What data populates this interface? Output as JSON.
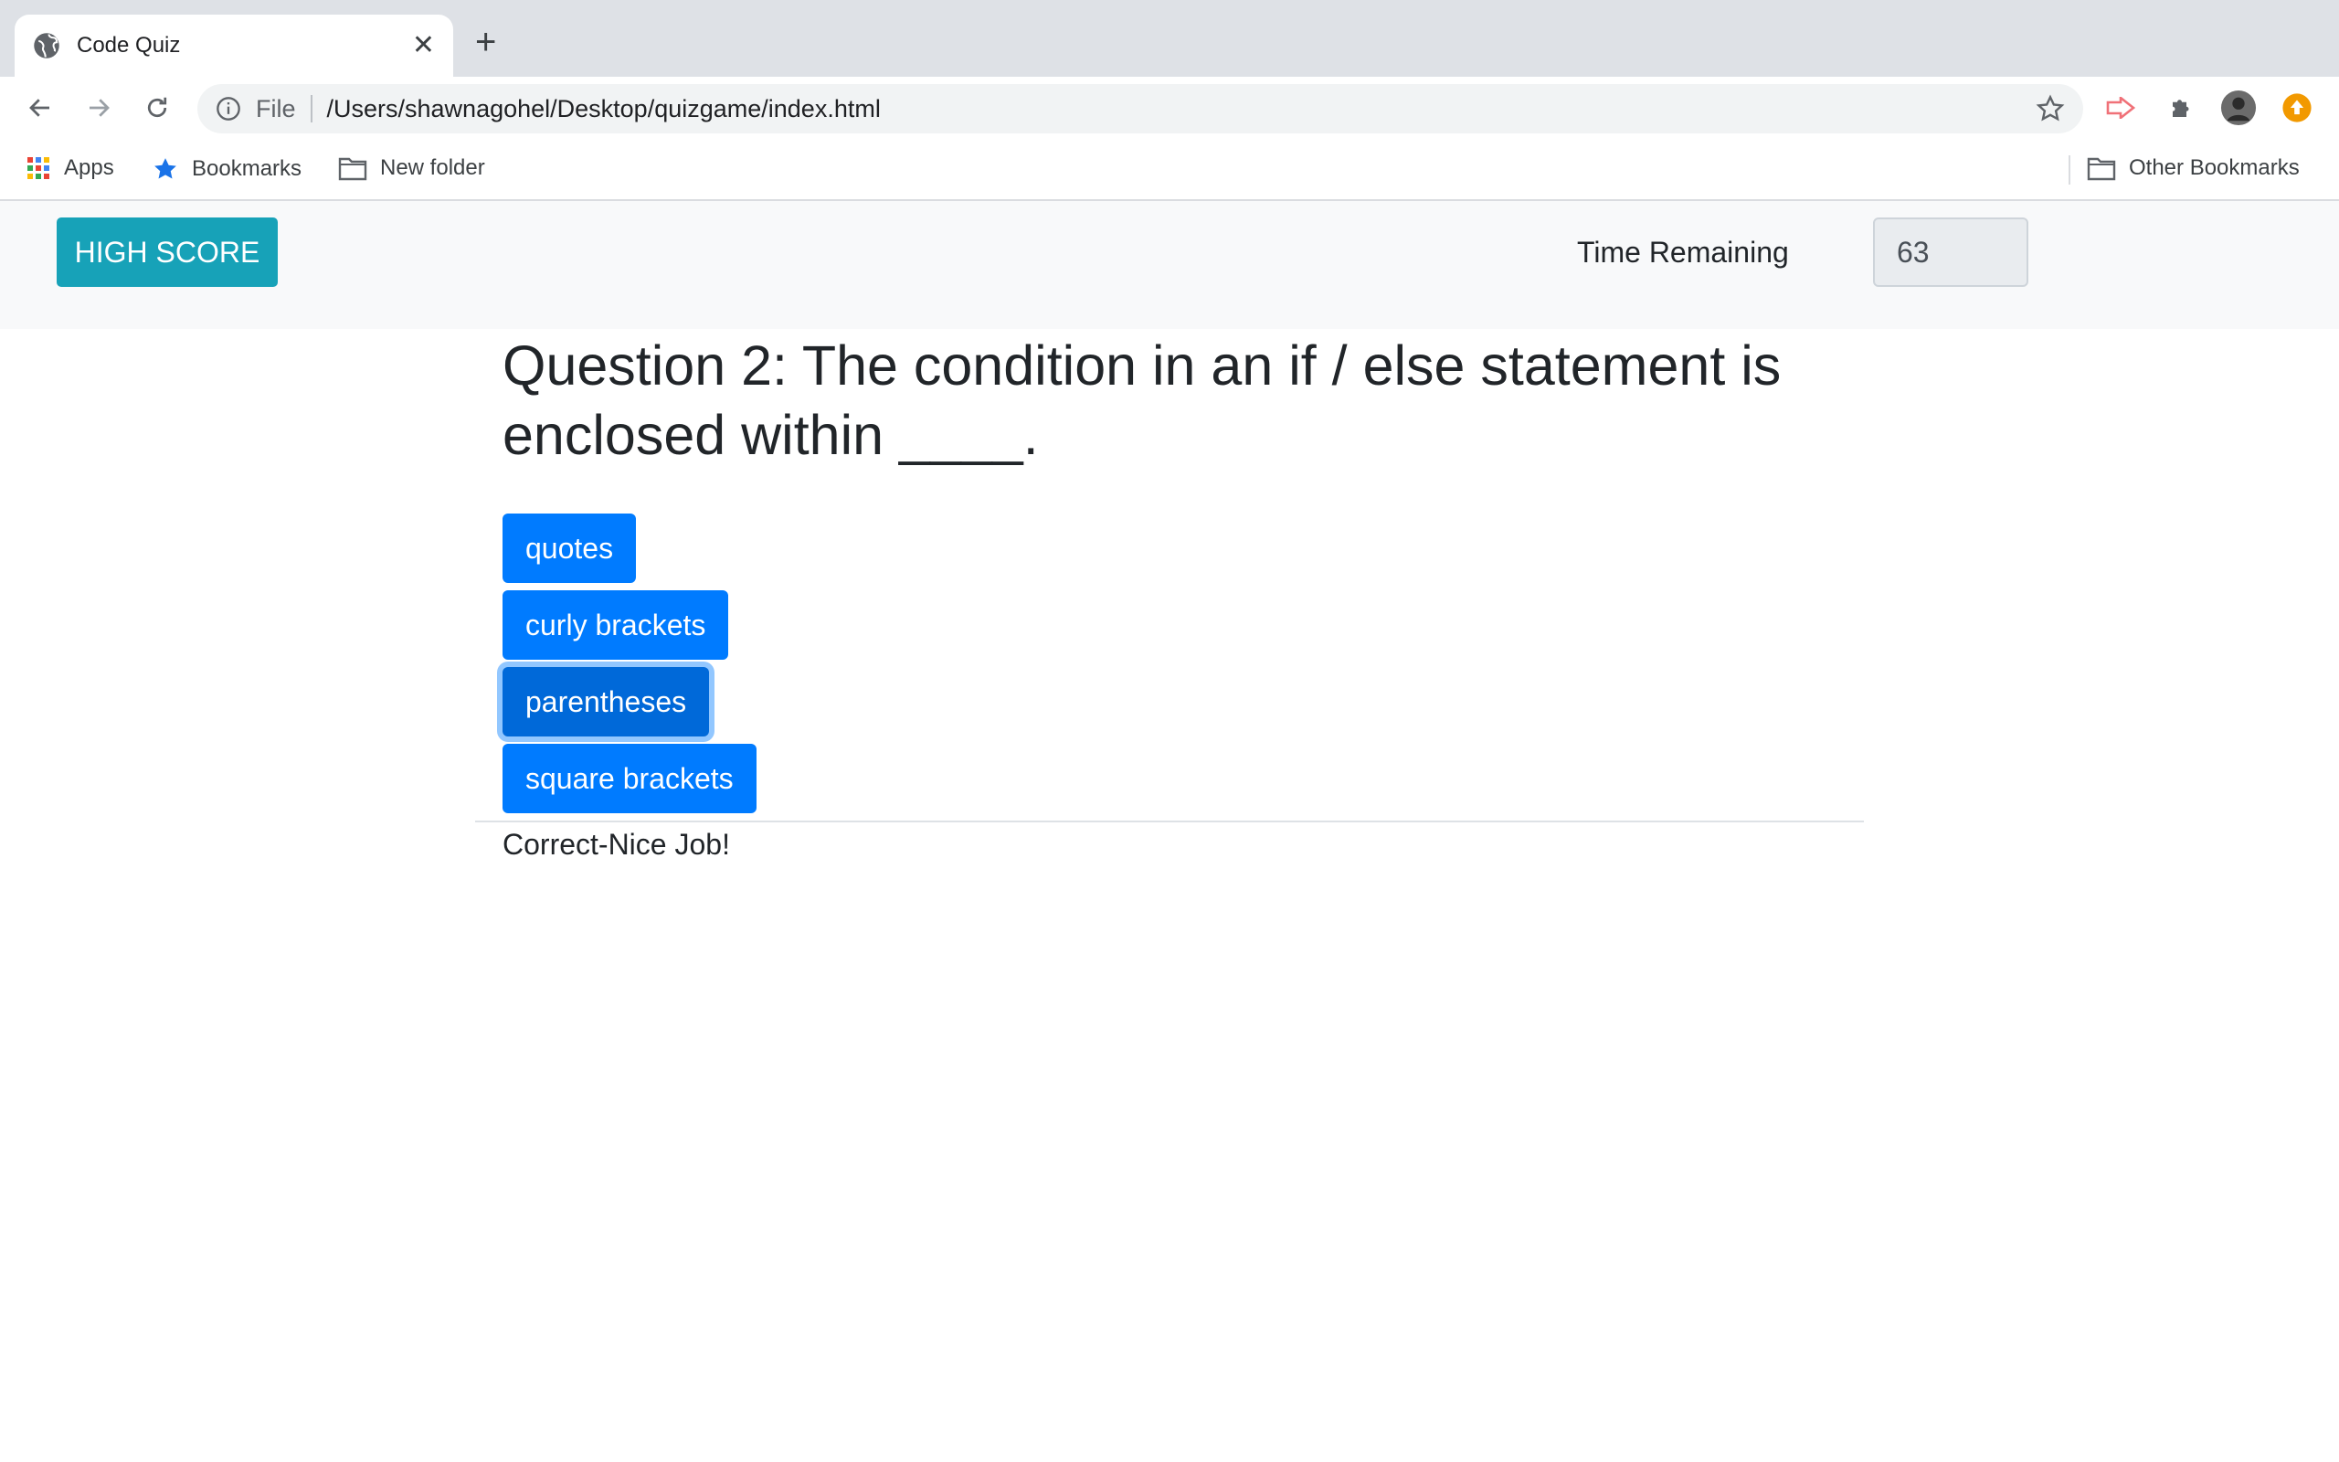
{
  "browser": {
    "tab_title": "Code Quiz",
    "tab_close": "✕",
    "new_tab": "+",
    "omnibox": {
      "scheme": "File",
      "url": "/Users/shawnagohel/Desktop/quizgame/index.html"
    },
    "bookmarks": [
      {
        "label": "Apps",
        "icon": "apps-grid-icon"
      },
      {
        "label": "Bookmarks",
        "icon": "star-icon"
      },
      {
        "label": "New folder",
        "icon": "folder-icon"
      }
    ],
    "other_bookmarks": "Other Bookmarks"
  },
  "page": {
    "high_score_label": "HIGH SCORE",
    "time_label": "Time Remaining",
    "time_value": "63",
    "question": "Question 2: The condition in an if / else statement is enclosed within ____.",
    "answers": [
      "quotes",
      "curly brackets",
      "parentheses",
      "square brackets"
    ],
    "selected_answer": "parentheses",
    "feedback": "Correct-Nice Job!"
  },
  "colors": {
    "high_score_btn": "#17a2b8",
    "answer_btn": "#007bff",
    "answer_btn_focused": "#0069d9",
    "navbar_bg": "#f8f9fa"
  }
}
